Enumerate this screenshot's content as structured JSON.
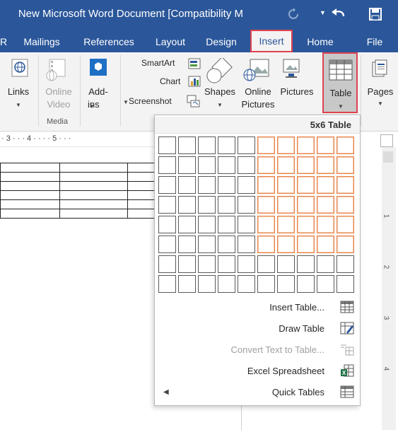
{
  "window": {
    "title": "New Microsoft Word Document [Compatibility M"
  },
  "quick_access": {
    "save_icon": "save-icon",
    "redo_icon": "redo-icon",
    "repeat_icon": "repeat-icon",
    "customize_icon": "dropdown-caret-icon"
  },
  "tabs": [
    {
      "label": "File",
      "active": false
    },
    {
      "label": "Home",
      "active": false
    },
    {
      "label": "Insert",
      "active": true
    },
    {
      "label": "Design",
      "active": false
    },
    {
      "label": "Layout",
      "active": false
    },
    {
      "label": "References",
      "active": false
    },
    {
      "label": "Mailings",
      "active": false
    },
    {
      "label": "R",
      "active": false
    }
  ],
  "ribbon": {
    "pages": "Pages",
    "table": "Table",
    "pictures": "Pictures",
    "online_pictures_line1": "Online",
    "online_pictures_line2": "Pictures",
    "shapes": "Shapes",
    "smartart": "SmartArt",
    "chart": "Chart",
    "screenshot": "Screenshot",
    "addins_line1": "Add-",
    "addins_line2": "ins",
    "online_video_line1": "Online",
    "online_video_line2": "Video",
    "media_group": "Media",
    "links": "Links"
  },
  "ruler": {
    "text": "· 3 · · · 4 · · · · 5 · · ·"
  },
  "vruler": {
    "n1": "1",
    "n2": "2",
    "n3": "3",
    "n4": "4"
  },
  "table_menu": {
    "header": "5x6 Table",
    "grid": {
      "columns": 10,
      "rows": 8,
      "selected_columns": 5,
      "selected_rows": 6
    },
    "items": [
      {
        "label": "Insert Table...",
        "icon": "insert-table-icon",
        "enabled": true
      },
      {
        "label": "Draw Table",
        "icon": "draw-table-icon",
        "enabled": true
      },
      {
        "label": "Convert Text to Table...",
        "icon": "convert-text-table-icon",
        "enabled": false
      },
      {
        "label": "Excel Spreadsheet",
        "icon": "excel-spreadsheet-icon",
        "enabled": true
      },
      {
        "label": "Quick Tables",
        "icon": "quick-tables-icon",
        "enabled": true
      }
    ]
  },
  "colors": {
    "brand": "#2b579a",
    "highlight_border": "#e0424f",
    "grid_selected": "#e8824a",
    "excel_green": "#217346"
  }
}
